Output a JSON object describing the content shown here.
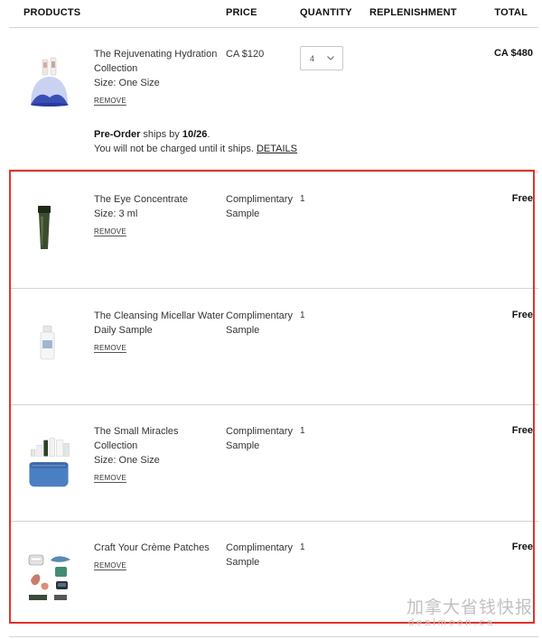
{
  "headers": {
    "products": "PRODUCTS",
    "price": "PRICE",
    "quantity": "QUANTITY",
    "replenishment": "REPLENISHMENT",
    "total": "TOTAL"
  },
  "items": [
    {
      "name_line1": "The Rejuvenating Hydration",
      "name_line2": "Collection",
      "size": "Size: One Size",
      "remove": "REMOVE",
      "price": "CA $120",
      "quantity": "4",
      "total": "CA $480",
      "preorder_label": "Pre-Order",
      "preorder_ships": " ships by ",
      "preorder_date": "10/26",
      "preorder_note": "You will not be charged until it ships. ",
      "details": "DETAILS"
    },
    {
      "name_line1": "The Eye Concentrate",
      "size": "Size: 3 ml",
      "remove": "REMOVE",
      "price_line1": "Complimentary",
      "price_line2": "Sample",
      "quantity": "1",
      "total": "Free"
    },
    {
      "name_line1": "The Cleansing Micellar Water",
      "name_line2": "Daily Sample",
      "remove": "REMOVE",
      "price_line1": "Complimentary",
      "price_line2": "Sample",
      "quantity": "1",
      "total": "Free"
    },
    {
      "name_line1": "The Small Miracles",
      "name_line2": "Collection",
      "size": "Size: One Size",
      "remove": "REMOVE",
      "price_line1": "Complimentary",
      "price_line2": "Sample",
      "quantity": "1",
      "total": "Free"
    },
    {
      "name_line1": "Craft Your Crème Patches",
      "remove": "REMOVE",
      "price_line1": "Complimentary",
      "price_line2": "Sample",
      "quantity": "1",
      "total": "Free"
    }
  ],
  "watermark": {
    "line1": "加拿大省钱快报",
    "line2": "dealmoon.ca"
  },
  "colors": {
    "highlight_border": "#e0342b",
    "divider": "#d4d4d4"
  },
  "icons": {
    "quantity_select": "chevron-down-icon"
  }
}
